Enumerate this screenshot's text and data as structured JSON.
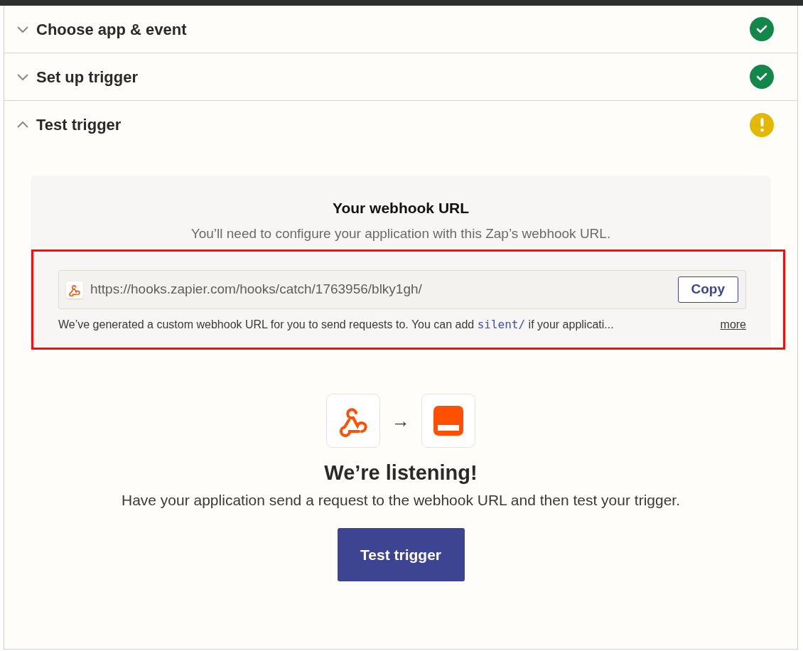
{
  "steps": [
    {
      "title": "Choose app & event",
      "expanded": false,
      "completed": true
    },
    {
      "title": "Set up trigger",
      "expanded": false,
      "completed": true
    },
    {
      "title": "Test trigger",
      "expanded": true,
      "completed": false
    }
  ],
  "webhook": {
    "title": "Your webhook URL",
    "subtitle": "You’ll need to configure your application with this Zap’s webhook URL.",
    "url": "https://hooks.zapier.com/hooks/catch/1763956/blky1gh/",
    "copy_button": "Copy",
    "note_parts": [
      {
        "kind": "text",
        "text": "We’ve generated a custom webhook URL for you to send requests to. You can add "
      },
      {
        "kind": "code",
        "text": "silent/"
      },
      {
        "kind": "text",
        "text": " if your applicati..."
      }
    ],
    "more_link": "more",
    "highlighted": true
  },
  "listening": {
    "arrow": "→",
    "title": "We’re listening!",
    "message": "Have your application send a request to the webhook URL and then test your trigger.",
    "button": "Test trigger"
  }
}
